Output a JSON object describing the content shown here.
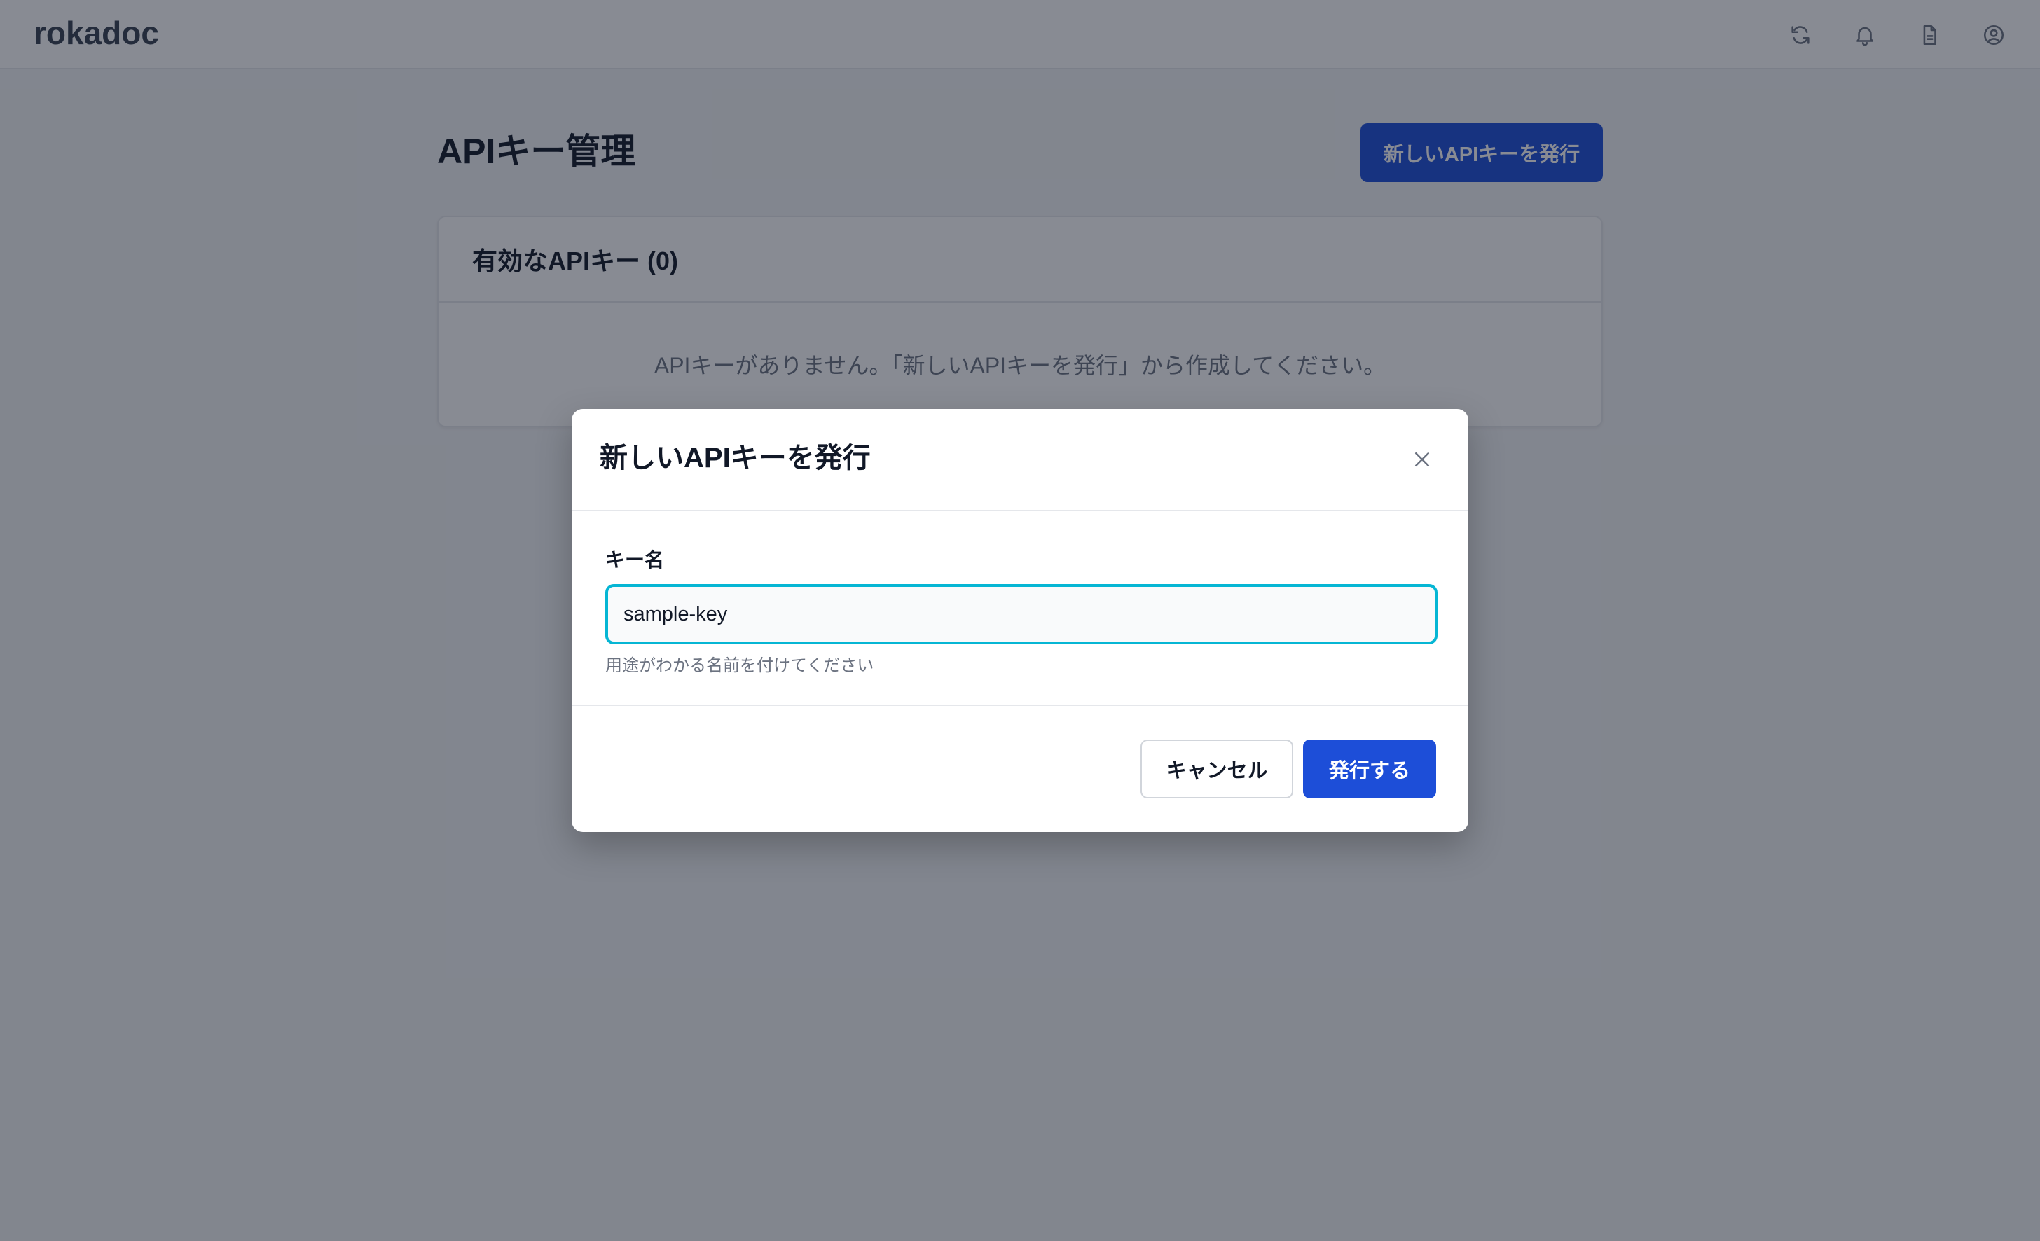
{
  "app": {
    "logo": "rokadoc"
  },
  "header": {
    "icons": [
      "refresh-icon",
      "bell-icon",
      "document-icon",
      "user-circle-icon"
    ]
  },
  "page": {
    "title": "APIキー管理",
    "issue_button_label": "新しいAPIキーを発行",
    "active_keys_title": "有効なAPIキー (0)",
    "empty_message": "APIキーがありません。「新しいAPIキーを発行」から作成してください。"
  },
  "modal": {
    "title": "新しいAPIキーを発行",
    "close_icon": "close-icon",
    "field_label": "キー名",
    "field_value": "sample-key",
    "field_hint": "用途がわかる名前を付けてください",
    "cancel_label": "キャンセル",
    "submit_label": "発行する"
  },
  "colors": {
    "primary": "#1d4ed8",
    "focus_ring": "#06b6d4",
    "overlay": "#111827"
  }
}
